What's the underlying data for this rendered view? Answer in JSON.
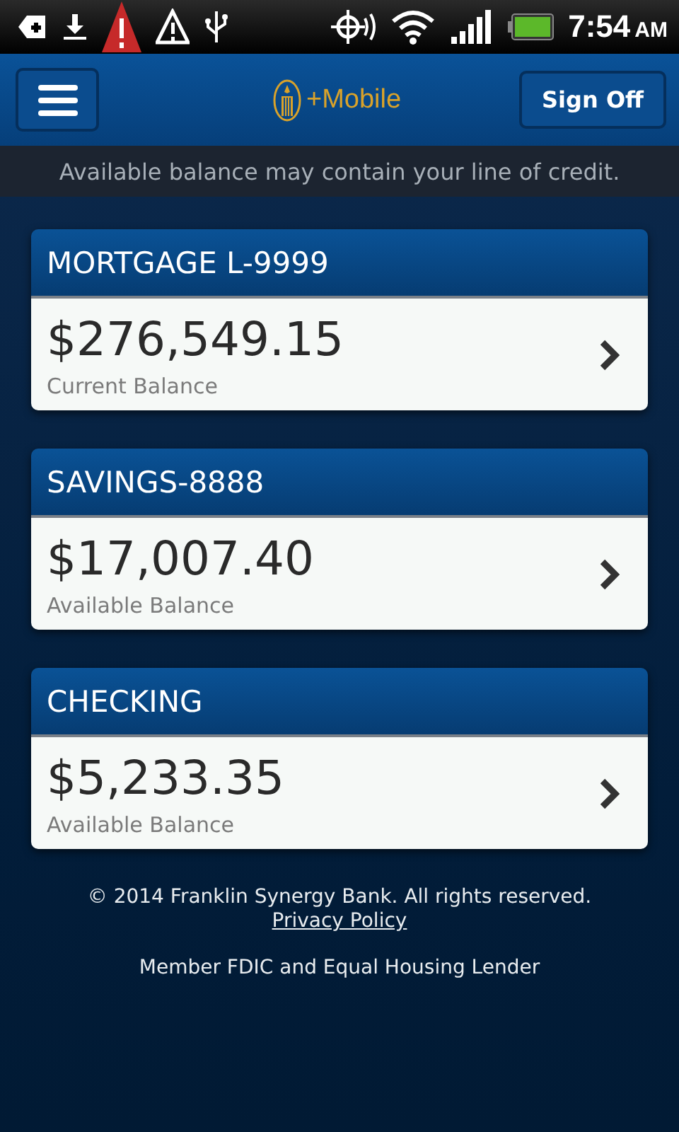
{
  "status_bar": {
    "time": "7:54",
    "ampm": "AM"
  },
  "header": {
    "logo_text": "+Mobile",
    "sign_off": "Sign Off"
  },
  "notice": "Available balance may contain your line of credit.",
  "accounts": [
    {
      "name": "MORTGAGE L-9999",
      "amount": "$276,549.15",
      "balance_label": "Current Balance"
    },
    {
      "name": "SAVINGS-8888",
      "amount": "$17,007.40",
      "balance_label": "Available Balance"
    },
    {
      "name": "CHECKING",
      "amount": "$5,233.35",
      "balance_label": "Available Balance"
    }
  ],
  "footer": {
    "copyright": "© 2014 Franklin Synergy Bank. All rights reserved.",
    "privacy_link": "Privacy Policy",
    "member": "Member FDIC and Equal Housing Lender"
  }
}
